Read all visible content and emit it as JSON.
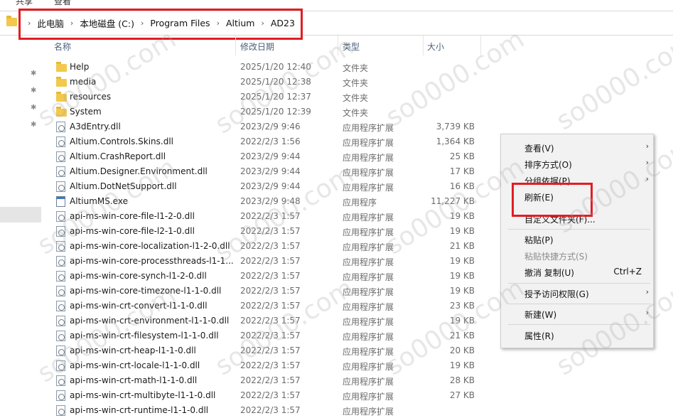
{
  "ribbon": {
    "share": "共享",
    "view": "查看"
  },
  "address_bar": {
    "crumbs": [
      "此电脑",
      "本地磁盘 (C:)",
      "Program Files",
      "Altium",
      "AD23"
    ]
  },
  "columns": {
    "name": "名称",
    "date": "修改日期",
    "type": "类型",
    "size": "大小"
  },
  "files": [
    {
      "name": "Help",
      "date": "2025/1/20 12:40",
      "type": "文件夹",
      "size": "",
      "kind": "folder"
    },
    {
      "name": "media",
      "date": "2025/1/20 12:38",
      "type": "文件夹",
      "size": "",
      "kind": "folder"
    },
    {
      "name": "resources",
      "date": "2025/1/20 12:37",
      "type": "文件夹",
      "size": "",
      "kind": "folder"
    },
    {
      "name": "System",
      "date": "2025/1/20 12:39",
      "type": "文件夹",
      "size": "",
      "kind": "folder"
    },
    {
      "name": "A3dEntry.dll",
      "date": "2023/2/9 9:46",
      "type": "应用程序扩展",
      "size": "3,739 KB",
      "kind": "dll"
    },
    {
      "name": "Altium.Controls.Skins.dll",
      "date": "2022/2/3 1:56",
      "type": "应用程序扩展",
      "size": "1,364 KB",
      "kind": "dll"
    },
    {
      "name": "Altium.CrashReport.dll",
      "date": "2023/2/9 9:44",
      "type": "应用程序扩展",
      "size": "25 KB",
      "kind": "dll"
    },
    {
      "name": "Altium.Designer.Environment.dll",
      "date": "2023/2/9 9:44",
      "type": "应用程序扩展",
      "size": "17 KB",
      "kind": "dll"
    },
    {
      "name": "Altium.DotNetSupport.dll",
      "date": "2023/2/9 9:44",
      "type": "应用程序扩展",
      "size": "16 KB",
      "kind": "dll"
    },
    {
      "name": "AltiumMS.exe",
      "date": "2023/2/9 9:48",
      "type": "应用程序",
      "size": "11,227 KB",
      "kind": "exe"
    },
    {
      "name": "api-ms-win-core-file-l1-2-0.dll",
      "date": "2022/2/3 1:57",
      "type": "应用程序扩展",
      "size": "19 KB",
      "kind": "dll"
    },
    {
      "name": "api-ms-win-core-file-l2-1-0.dll",
      "date": "2022/2/3 1:57",
      "type": "应用程序扩展",
      "size": "19 KB",
      "kind": "dll"
    },
    {
      "name": "api-ms-win-core-localization-l1-2-0.dll",
      "date": "2022/2/3 1:57",
      "type": "应用程序扩展",
      "size": "21 KB",
      "kind": "dll"
    },
    {
      "name": "api-ms-win-core-processthreads-l1-1...",
      "date": "2022/2/3 1:57",
      "type": "应用程序扩展",
      "size": "19 KB",
      "kind": "dll"
    },
    {
      "name": "api-ms-win-core-synch-l1-2-0.dll",
      "date": "2022/2/3 1:57",
      "type": "应用程序扩展",
      "size": "19 KB",
      "kind": "dll"
    },
    {
      "name": "api-ms-win-core-timezone-l1-1-0.dll",
      "date": "2022/2/3 1:57",
      "type": "应用程序扩展",
      "size": "19 KB",
      "kind": "dll"
    },
    {
      "name": "api-ms-win-crt-convert-l1-1-0.dll",
      "date": "2022/2/3 1:57",
      "type": "应用程序扩展",
      "size": "23 KB",
      "kind": "dll"
    },
    {
      "name": "api-ms-win-crt-environment-l1-1-0.dll",
      "date": "2022/2/3 1:57",
      "type": "应用程序扩展",
      "size": "19 KB",
      "kind": "dll"
    },
    {
      "name": "api-ms-win-crt-filesystem-l1-1-0.dll",
      "date": "2022/2/3 1:57",
      "type": "应用程序扩展",
      "size": "21 KB",
      "kind": "dll"
    },
    {
      "name": "api-ms-win-crt-heap-l1-1-0.dll",
      "date": "2022/2/3 1:57",
      "type": "应用程序扩展",
      "size": "20 KB",
      "kind": "dll"
    },
    {
      "name": "api-ms-win-crt-locale-l1-1-0.dll",
      "date": "2022/2/3 1:57",
      "type": "应用程序扩展",
      "size": "19 KB",
      "kind": "dll"
    },
    {
      "name": "api-ms-win-crt-math-l1-1-0.dll",
      "date": "2022/2/3 1:57",
      "type": "应用程序扩展",
      "size": "28 KB",
      "kind": "dll"
    },
    {
      "name": "api-ms-win-crt-multibyte-l1-1-0.dll",
      "date": "2022/2/3 1:57",
      "type": "应用程序扩展",
      "size": "27 KB",
      "kind": "dll"
    },
    {
      "name": "api-ms-win-crt-runtime-l1-1-0.dll",
      "date": "2022/2/3 1:57",
      "type": "应用程序扩展",
      "size": "",
      "kind": "dll"
    }
  ],
  "context_menu": {
    "items": [
      {
        "label": "查看(V)",
        "submenu": true
      },
      {
        "label": "排序方式(O)",
        "submenu": true
      },
      {
        "label": "分组依据(P)",
        "submenu": true
      },
      {
        "label": "刷新(E)"
      },
      {
        "label": "自定义文件夹(F)..."
      },
      {
        "label": "粘贴(P)"
      },
      {
        "label": "粘贴快捷方式(S)",
        "disabled": true
      },
      {
        "label": "撤消 复制(U)",
        "shortcut": "Ctrl+Z"
      },
      {
        "label": "授予访问权限(G)",
        "submenu": true
      },
      {
        "label": "新建(W)",
        "submenu": true
      },
      {
        "label": "属性(R)"
      }
    ]
  },
  "watermark": "so0000.com"
}
